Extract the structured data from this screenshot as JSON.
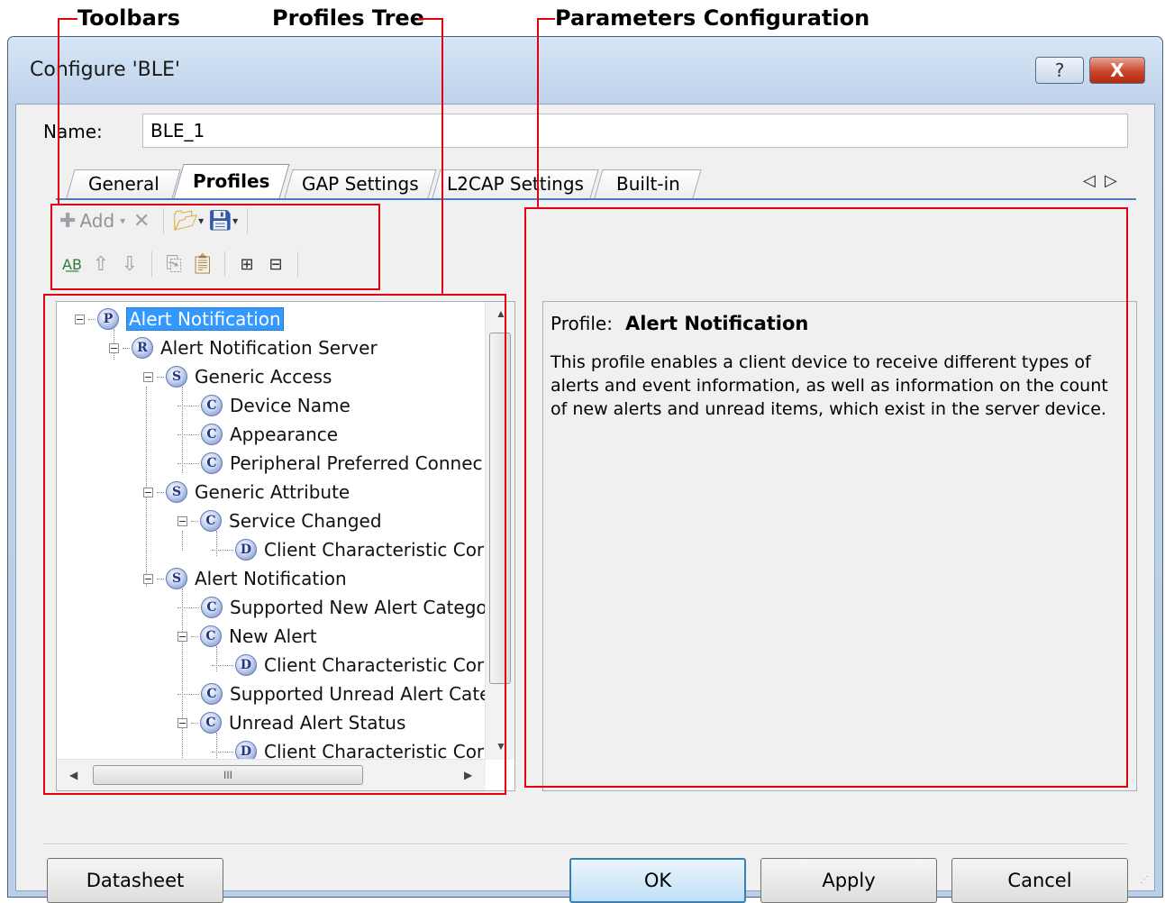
{
  "annotations": {
    "toolbars": "Toolbars",
    "profiles_tree": "Profiles Tree",
    "parameters_configuration": "Parameters Configuration"
  },
  "window": {
    "title": "Configure 'BLE'",
    "help_button": "?",
    "close_button": "X"
  },
  "name_field": {
    "label": "Name:",
    "value": "BLE_1"
  },
  "tabs": [
    {
      "label": "General"
    },
    {
      "label": "Profiles"
    },
    {
      "label": "GAP Settings"
    },
    {
      "label": "L2CAP Settings"
    },
    {
      "label": "Built-in"
    }
  ],
  "toolbar": {
    "add_label": "Add"
  },
  "tree": {
    "nodes": [
      {
        "badge": "P",
        "label": "Alert Notification",
        "selected": true
      },
      {
        "badge": "R",
        "label": "Alert Notification Server"
      },
      {
        "badge": "S",
        "label": "Generic Access"
      },
      {
        "badge": "C",
        "label": "Device Name"
      },
      {
        "badge": "C",
        "label": "Appearance"
      },
      {
        "badge": "C",
        "label": "Peripheral Preferred Connec"
      },
      {
        "badge": "S",
        "label": "Generic Attribute"
      },
      {
        "badge": "C",
        "label": "Service Changed"
      },
      {
        "badge": "D",
        "label": "Client Characteristic Cor"
      },
      {
        "badge": "S",
        "label": "Alert Notification"
      },
      {
        "badge": "C",
        "label": "Supported New Alert Catego"
      },
      {
        "badge": "C",
        "label": "New Alert"
      },
      {
        "badge": "D",
        "label": "Client Characteristic Cor"
      },
      {
        "badge": "C",
        "label": "Supported Unread Alert Cate"
      },
      {
        "badge": "C",
        "label": "Unread Alert Status"
      },
      {
        "badge": "D",
        "label": "Client Characteristic Cor"
      }
    ]
  },
  "params": {
    "profile_label": "Profile:",
    "profile_name": "Alert Notification",
    "description": "This profile enables a client device to receive different types of alerts and event information, as well as information on the count of new alerts and unread items, which exist in the server device."
  },
  "buttons": {
    "datasheet": "Datasheet",
    "ok": "OK",
    "apply": "Apply",
    "cancel": "Cancel"
  },
  "colors": {
    "highlight": "#e3000f",
    "selection": "#3399ff"
  }
}
